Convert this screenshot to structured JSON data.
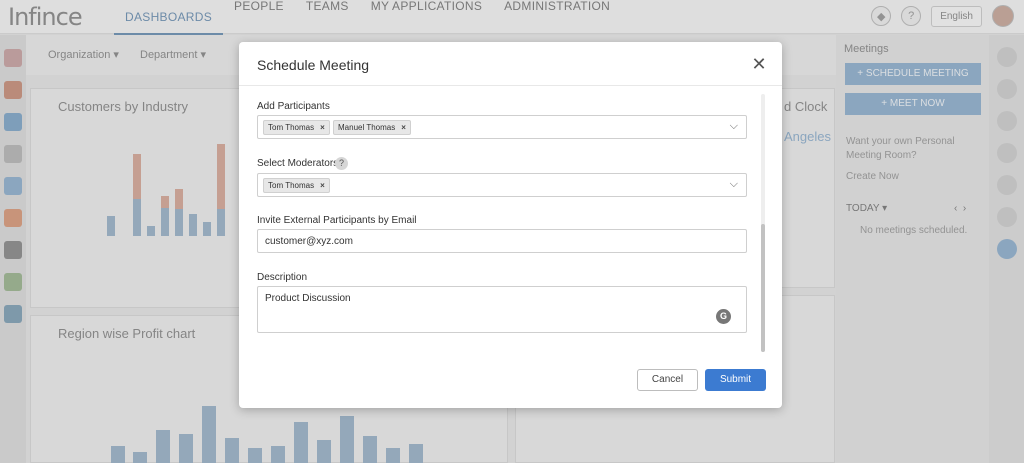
{
  "app": {
    "logo": "Infince",
    "nav": [
      "DASHBOARDS",
      "PEOPLE",
      "TEAMS",
      "MY APPLICATIONS",
      "ADMINISTRATION"
    ],
    "language": "English",
    "filters": [
      "Organization ▾",
      "Department ▾"
    ],
    "cards": {
      "customers_title": "Customers by Industry",
      "region_title": "Region wise Profit chart",
      "world_clock_partial": "d Clock",
      "city_partial": "Angeles"
    },
    "meetings_panel": {
      "title": "Meetings",
      "schedule_button": "+     SCHEDULE MEETING",
      "meet_now_button": "+     MEET NOW",
      "room_prompt": "Want your own Personal Meeting Room?",
      "create_now": "Create Now",
      "today_label": "TODAY ▾",
      "empty_text": "No meetings scheduled."
    }
  },
  "modal": {
    "title": "Schedule Meeting",
    "participants_label": "Add Participants",
    "participants": [
      "Tom Thomas",
      "Manuel Thomas"
    ],
    "moderators_label": "Select Moderators",
    "moderators": [
      "Tom Thomas"
    ],
    "email_label": "Invite External Participants by Email",
    "email_value": "customer@xyz.com",
    "description_label": "Description",
    "description_value": "Product Discussion",
    "cancel_label": "Cancel",
    "submit_label": "Submit"
  },
  "colors": {
    "submit": "#3c7bd1",
    "nav_active": "#6a8fb3"
  }
}
